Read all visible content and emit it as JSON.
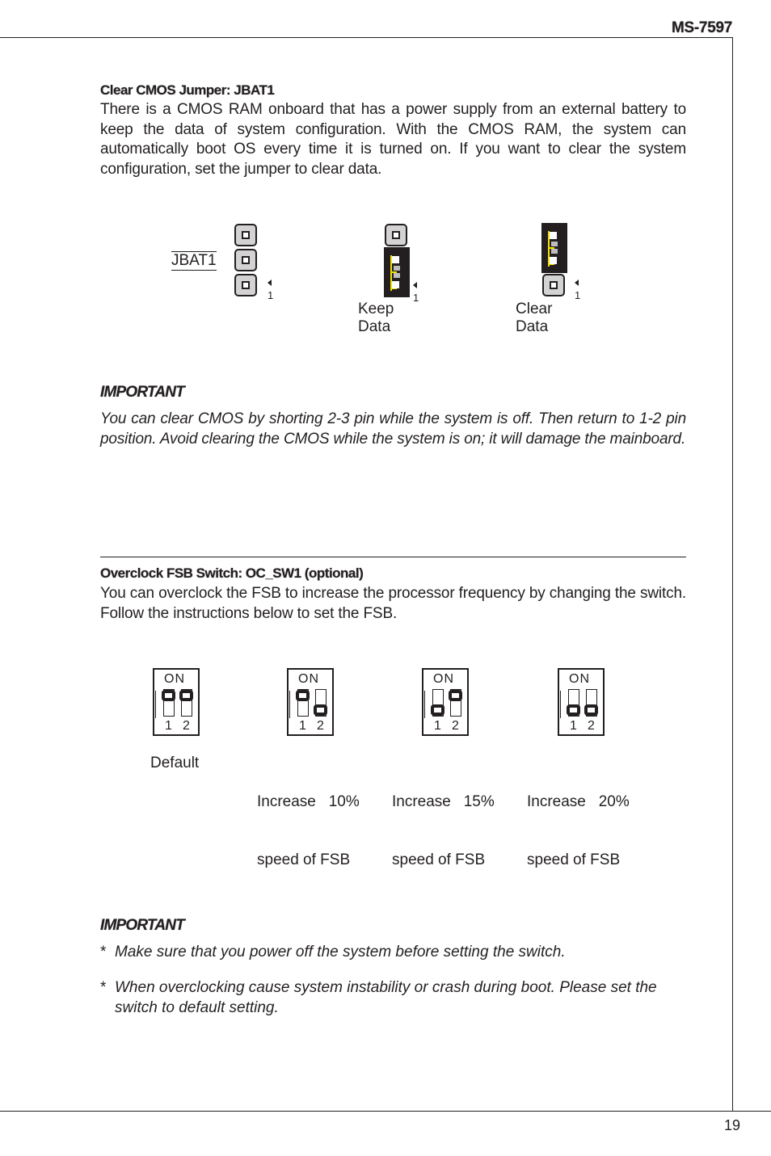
{
  "header": {
    "model": "MS-7597"
  },
  "footer": {
    "page_number": "19"
  },
  "jbat": {
    "title": "Clear CMOS Jumper: JBAT1",
    "body": "There is a CMOS RAM onboard that has a power supply from an external battery to keep the data of system configuration. With the CMOS RAM, the system can automatically boot OS every time it is turned on. If you want to clear the system configuration, set the jumper to clear data.",
    "connector_label": "JBAT1",
    "pin_marker": "1",
    "diagrams": [
      {
        "label": "",
        "cap": "none"
      },
      {
        "label": "Keep Data",
        "cap": "pins 1-2"
      },
      {
        "label": "Clear Data",
        "cap": "pins 2-3"
      }
    ],
    "important_title": "IMPORTANT",
    "important_body": "You can clear CMOS by shorting 2-3 pin while the system is off. Then return to 1-2 pin position. Avoid clearing the CMOS while the system is on; it will damage the mainboard."
  },
  "ocsw": {
    "title": "Overclock FSB Switch: OC_SW1 (optional)",
    "body": "You can overclock the FSB to increase the processor frequency by changing the switch. Follow the instructions below to set the FSB.",
    "switch_on_label": "ON",
    "switch_numbers": [
      "1",
      "2"
    ],
    "settings": [
      {
        "label_line1": "Default",
        "label_line2": "",
        "switch1": "on",
        "switch2": "on"
      },
      {
        "label_line1": "Increase   10%",
        "label_line2": "speed of FSB",
        "switch1": "on",
        "switch2": "off"
      },
      {
        "label_line1": "Increase   15%",
        "label_line2": "speed of FSB",
        "switch1": "off",
        "switch2": "on"
      },
      {
        "label_line1": "Increase   20%",
        "label_line2": "speed of FSB",
        "switch1": "off",
        "switch2": "off"
      }
    ],
    "important_title": "IMPORTANT",
    "bullets": [
      {
        "star": "*",
        "text": "Make sure that you power off the system before setting the switch."
      },
      {
        "star": "*",
        "text": "When overclocking cause system instability or crash during boot. Please set the switch to default setting."
      }
    ]
  }
}
